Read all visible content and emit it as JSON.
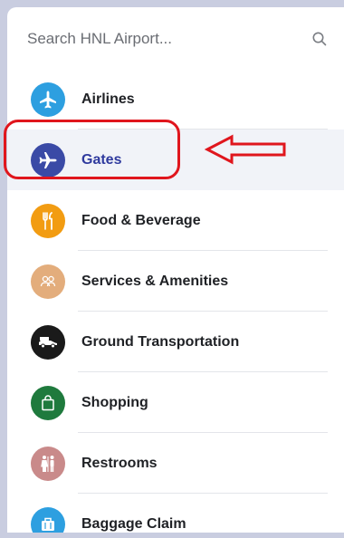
{
  "search": {
    "placeholder": "Search HNL Airport..."
  },
  "menu": {
    "items": [
      {
        "label": "Airlines",
        "icon": "airplane-icon",
        "color": "#2d9fe0"
      },
      {
        "label": "Gates",
        "icon": "airplane-icon",
        "color": "#3a4aa6",
        "active": true
      },
      {
        "label": "Food & Beverage",
        "icon": "fork-knife-icon",
        "color": "#f29c12"
      },
      {
        "label": "Services & Amenities",
        "icon": "people-icon",
        "color": "#e3ad7c"
      },
      {
        "label": "Ground Transportation",
        "icon": "car-icon",
        "color": "#1a1a1a"
      },
      {
        "label": "Shopping",
        "icon": "shopping-bag-icon",
        "color": "#1f7a3d"
      },
      {
        "label": "Restrooms",
        "icon": "restroom-icon",
        "color": "#c98a8a"
      },
      {
        "label": "Baggage Claim",
        "icon": "luggage-icon",
        "color": "#2d9fe0"
      }
    ]
  },
  "annotation": {
    "color": "#e0161d"
  }
}
